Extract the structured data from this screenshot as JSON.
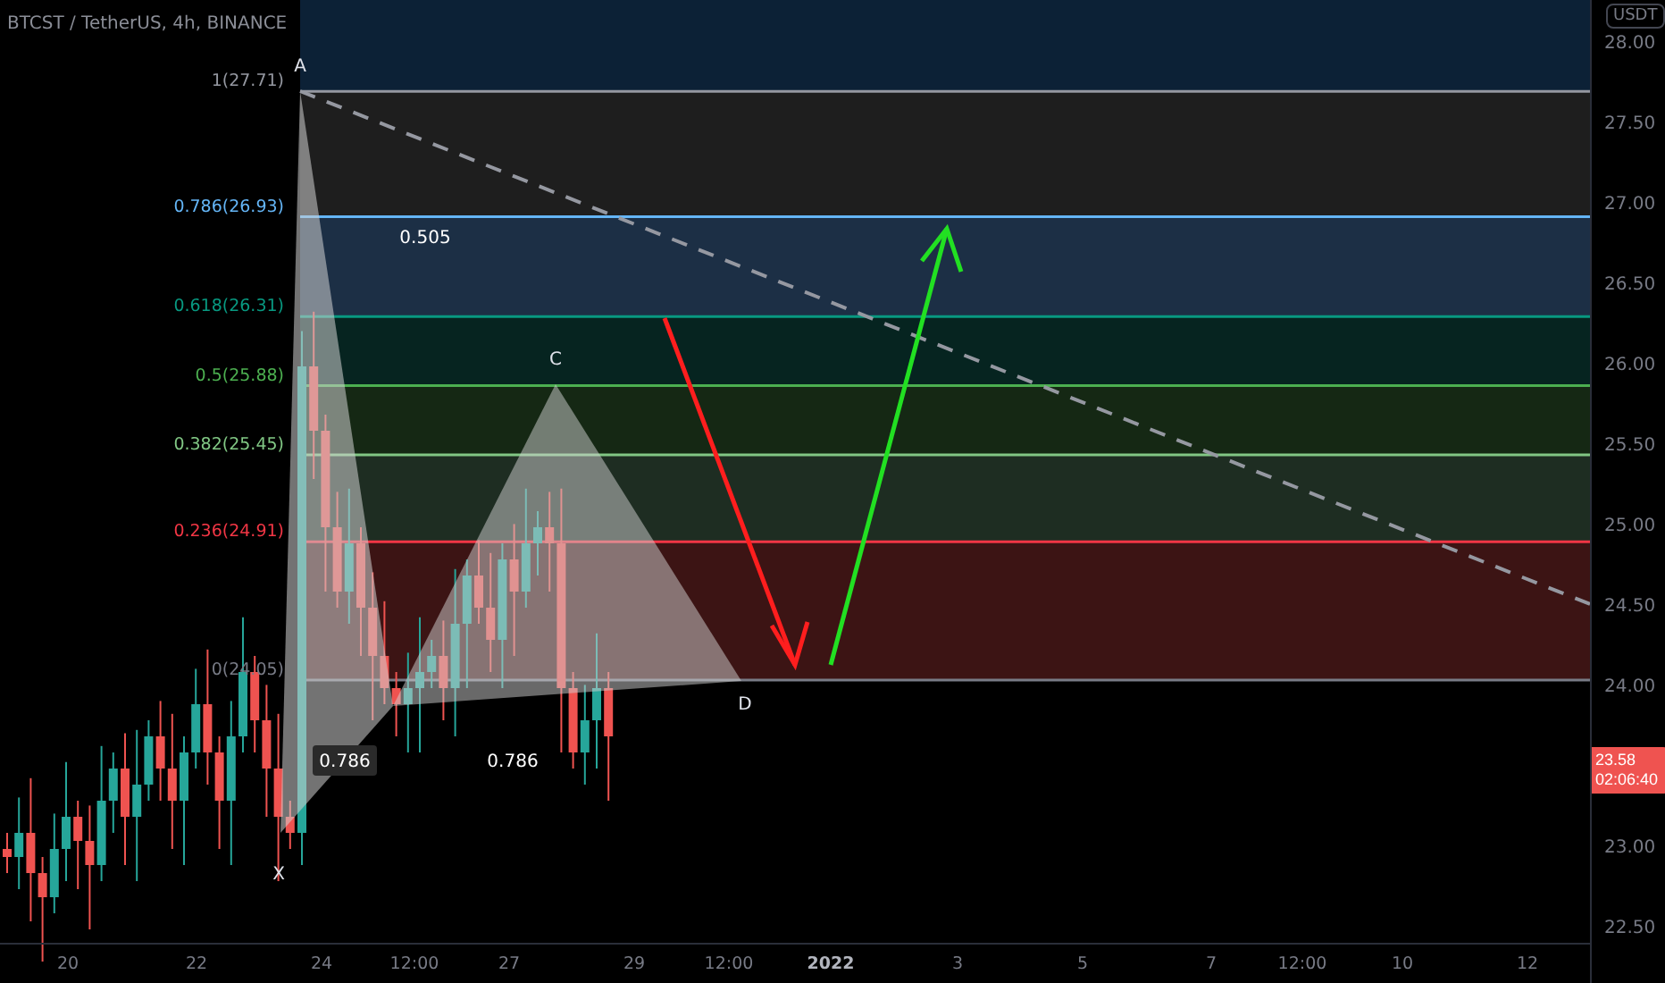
{
  "header": {
    "title": "BTCST / TetherUS, 4h, BINANCE"
  },
  "price_axis": {
    "currency": "USDT",
    "ticks": [
      "28.00",
      "27.50",
      "27.00",
      "26.50",
      "26.00",
      "25.50",
      "25.00",
      "24.50",
      "24.00",
      "23.00",
      "22.50"
    ]
  },
  "current_price": {
    "price": "23.58",
    "countdown": "02:06:40"
  },
  "fib_levels": [
    {
      "label": "1(27.71)",
      "color": "#9598a1"
    },
    {
      "label": "0.786(26.93)",
      "color": "#64b5f6"
    },
    {
      "label": "0.618(26.31)",
      "color": "#089981"
    },
    {
      "label": "0.5(25.88)",
      "color": "#4caf50"
    },
    {
      "label": "0.382(25.45)",
      "color": "#81c784"
    },
    {
      "label": "0.236(24.91)",
      "color": "#f23645"
    },
    {
      "label": "0(24.05)",
      "color": "#787b86"
    }
  ],
  "pattern_points": [
    "A",
    "C",
    "X",
    "D"
  ],
  "ratios": [
    {
      "text": "0.505",
      "kind": "plain"
    },
    {
      "text": "0.786",
      "kind": "boxed"
    },
    {
      "text": "0.786",
      "kind": "plain"
    }
  ],
  "time_axis": [
    {
      "label": "20",
      "bold": false
    },
    {
      "label": "22",
      "bold": false
    },
    {
      "label": "24",
      "bold": false
    },
    {
      "label": "12:00",
      "bold": false
    },
    {
      "label": "27",
      "bold": false
    },
    {
      "label": "29",
      "bold": false
    },
    {
      "label": "12:00",
      "bold": false
    },
    {
      "label": "2022",
      "bold": true
    },
    {
      "label": "3",
      "bold": false
    },
    {
      "label": "5",
      "bold": false
    },
    {
      "label": "7",
      "bold": false
    },
    {
      "label": "12:00",
      "bold": false
    },
    {
      "label": "10",
      "bold": false
    },
    {
      "label": "12",
      "bold": false
    }
  ]
}
